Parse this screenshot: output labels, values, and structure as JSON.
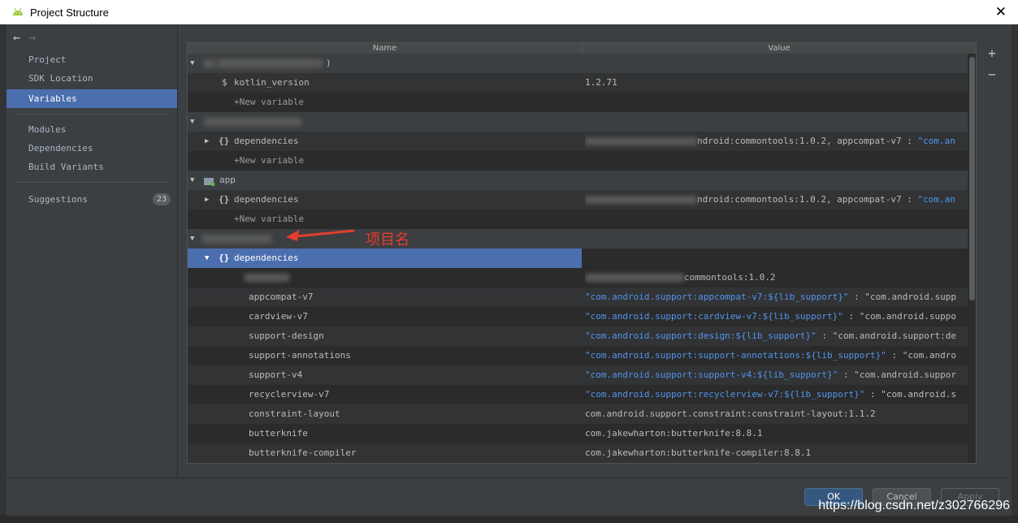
{
  "window": {
    "title": "Project Structure",
    "close_glyph": "✕"
  },
  "nav": {
    "back": "←",
    "forward": "→"
  },
  "sidebar": {
    "items": [
      {
        "label": "Project"
      },
      {
        "label": "SDK Location"
      },
      {
        "label": "Variables",
        "selected": true
      },
      {
        "label": "Modules"
      },
      {
        "label": "Dependencies"
      },
      {
        "label": "Build Variants"
      },
      {
        "label": "Suggestions",
        "badge": "23"
      }
    ]
  },
  "table": {
    "headers": {
      "name": "Name",
      "value": "Value"
    },
    "rows": [
      {
        "name": ")",
        "value": ""
      },
      {
        "name": "kotlin_version",
        "value": "1.2.71"
      },
      {
        "name": "+New variable",
        "value": ""
      },
      {
        "name": "",
        "value": ""
      },
      {
        "name": "dependencies",
        "value": "ndroid:commontools:1.0.2, appcompat-v7 : ",
        "value_blue": "\"com.an"
      },
      {
        "name": "+New variable",
        "value": ""
      },
      {
        "name": "app",
        "value": ""
      },
      {
        "name": "dependencies",
        "value": "ndroid:commontools:1.0.2, appcompat-v7 : ",
        "value_blue": "\"com.an"
      },
      {
        "name": "+New variable",
        "value": ""
      },
      {
        "name": "",
        "value": ""
      },
      {
        "name": "dependencies",
        "value": ""
      },
      {
        "name": "",
        "value": "commontools:1.0.2"
      },
      {
        "name": "appcompat-v7",
        "value_blue": "\"com.android.support:appcompat-v7:${lib_support}\"",
        "value": " : \"com.android.supp"
      },
      {
        "name": "cardview-v7",
        "value_blue": "\"com.android.support:cardview-v7:${lib_support}\"",
        "value": " : \"com.android.suppo"
      },
      {
        "name": "support-design",
        "value_blue": "\"com.android.support:design:${lib_support}\"",
        "value": " : \"com.android.support:de"
      },
      {
        "name": "support-annotations",
        "value_blue": "\"com.android.support:support-annotations:${lib_support}\"",
        "value": " : \"com.andro"
      },
      {
        "name": "support-v4",
        "value_blue": "\"com.android.support:support-v4:${lib_support}\"",
        "value": " : \"com.android.suppor"
      },
      {
        "name": "recyclerview-v7",
        "value_blue": "\"com.android.support:recyclerview-v7:${lib_support}\"",
        "value": " : \"com.android.s"
      },
      {
        "name": "constraint-layout",
        "value": "com.android.support.constraint:constraint-layout:1.1.2"
      },
      {
        "name": "butterknife",
        "value": "com.jakewharton:butterknife:8.8.1"
      },
      {
        "name": "butterknife-compiler",
        "value": "com.jakewharton:butterknife-compiler:8.8.1"
      }
    ]
  },
  "toolbar": {
    "add": "+",
    "remove": "−"
  },
  "buttons": {
    "ok": "OK",
    "cancel": "Cancel",
    "apply": "Apply"
  },
  "annotation": {
    "text": "项目名"
  },
  "watermark": "https://blog.csdn.net/z302766296",
  "colors": {
    "accent": "#4b6eaf",
    "link": "#5394ec",
    "annotation": "#e53c2b"
  }
}
